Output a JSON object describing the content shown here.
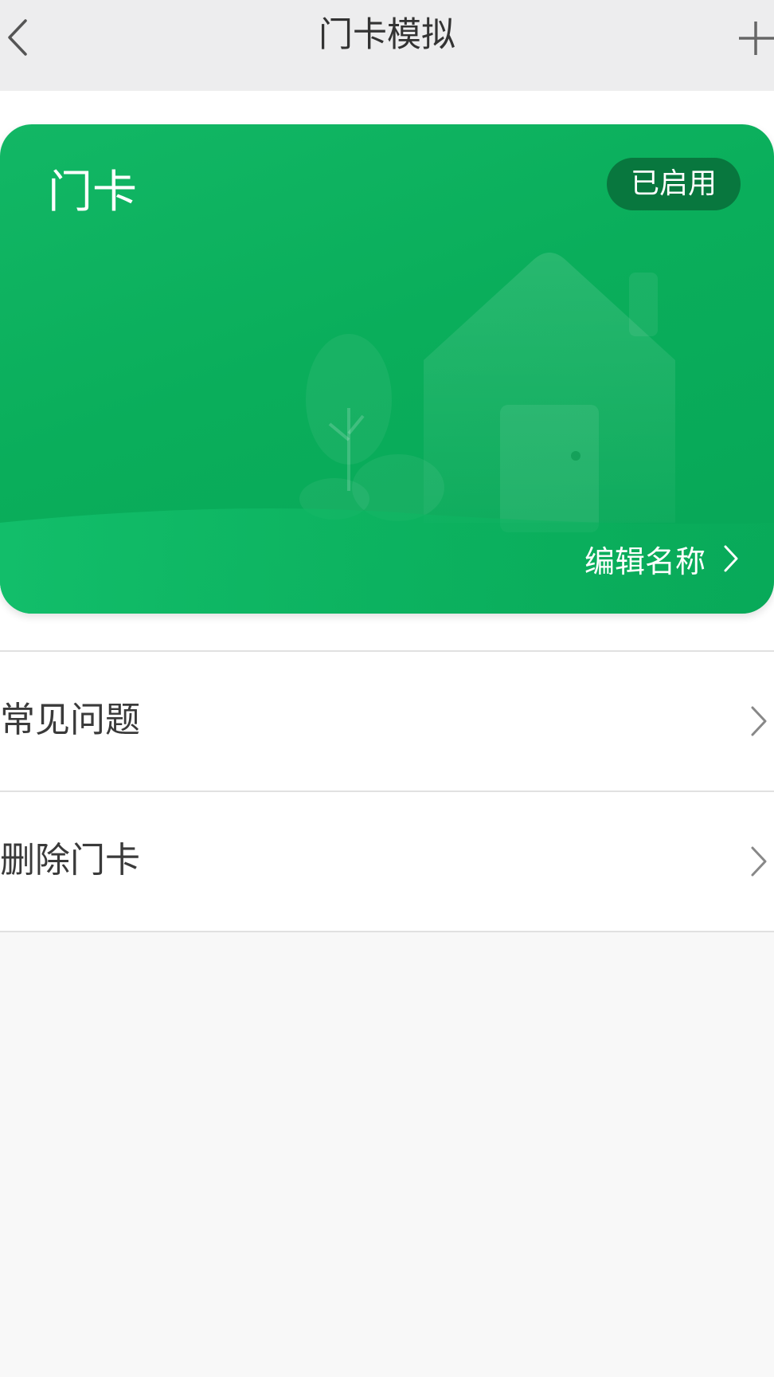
{
  "header": {
    "title": "门卡模拟",
    "back_icon": "chevron-left-icon",
    "add_icon": "plus-icon"
  },
  "card": {
    "name": "门卡",
    "status": "已启用",
    "edit_label": "编辑名称",
    "edit_icon": "chevron-right-icon",
    "accent_color": "#0aae5b",
    "badge_color": "#08773e"
  },
  "menu": {
    "items": [
      {
        "label": "常见问题",
        "icon": "chevron-right-icon"
      },
      {
        "label": "删除门卡",
        "icon": "chevron-right-icon"
      }
    ]
  }
}
